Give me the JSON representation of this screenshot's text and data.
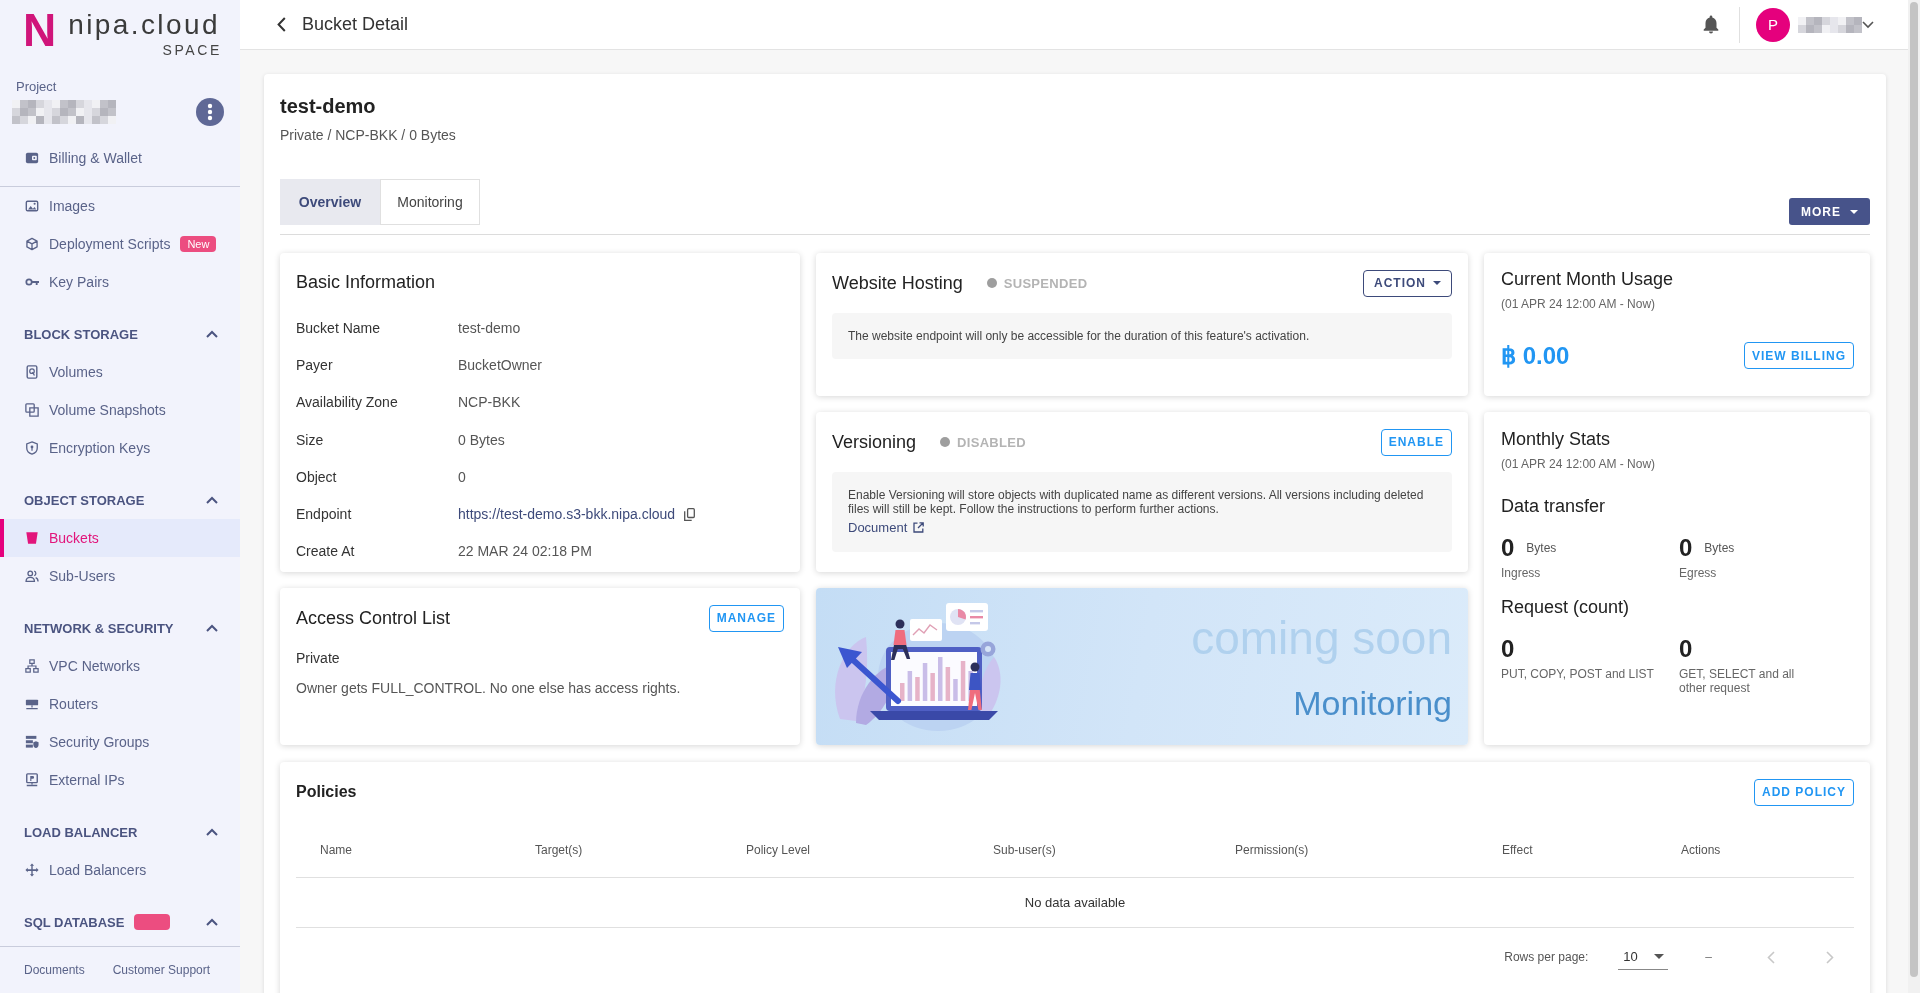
{
  "sidebar": {
    "logo": {
      "mark": "N",
      "name": "nipa.cloud",
      "tagline": "SPACE"
    },
    "project": {
      "label": "Project"
    },
    "pinned": [
      {
        "label": "Billing & Wallet",
        "selected": false
      }
    ],
    "sections": [
      {
        "items": [
          {
            "label": "Images",
            "selected": false
          },
          {
            "label": "Deployment Scripts",
            "badge": "New",
            "selected": false
          },
          {
            "label": "Key Pairs",
            "selected": false
          }
        ]
      },
      {
        "heading": "BLOCK STORAGE",
        "expanded": true,
        "items": [
          {
            "label": "Volumes",
            "selected": false
          },
          {
            "label": "Volume Snapshots",
            "selected": false
          },
          {
            "label": "Encryption Keys",
            "selected": false
          }
        ]
      },
      {
        "heading": "OBJECT STORAGE",
        "expanded": true,
        "items": [
          {
            "label": "Buckets",
            "selected": true
          },
          {
            "label": "Sub-Users",
            "selected": false
          }
        ]
      },
      {
        "heading": "NETWORK & SECURITY",
        "expanded": true,
        "items": [
          {
            "label": "VPC Networks",
            "selected": false
          },
          {
            "label": "Routers",
            "selected": false
          },
          {
            "label": "Security Groups",
            "selected": false
          },
          {
            "label": "External IPs",
            "selected": false
          }
        ]
      },
      {
        "heading": "LOAD BALANCER",
        "expanded": true,
        "items": [
          {
            "label": "Load Balancers",
            "selected": false
          }
        ]
      },
      {
        "heading": "SQL DATABASE",
        "tagged": true,
        "expanded": true
      }
    ],
    "footer_links": [
      "Documents",
      "Customer Support"
    ]
  },
  "header": {
    "title": "Bucket Detail",
    "avatar_initial": "P"
  },
  "bucket": {
    "name": "test-demo",
    "summary": "Private / NCP-BKK / 0 Bytes"
  },
  "tabs": [
    {
      "label": "Overview",
      "selected": true
    },
    {
      "label": "Monitoring",
      "selected": false
    }
  ],
  "more_button": "MORE",
  "basic_information": {
    "title": "Basic Information",
    "fields": [
      {
        "label": "Bucket Name",
        "value": "test-demo",
        "kind": "text"
      },
      {
        "label": "Payer",
        "value": "BucketOwner",
        "kind": "text"
      },
      {
        "label": "Availability Zone",
        "value": "NCP-BKK",
        "kind": "text"
      },
      {
        "label": "Size",
        "value": "0 Bytes",
        "kind": "text"
      },
      {
        "label": "Object",
        "value": "0",
        "kind": "text"
      },
      {
        "label": "Endpoint",
        "value": "https://test-demo.s3-bkk.nipa.cloud",
        "kind": "link"
      },
      {
        "label": "Create At",
        "value": "22 MAR 24 02:18 PM",
        "kind": "text"
      }
    ]
  },
  "features": [
    {
      "title": "Website Hosting",
      "status": "SUSPENDED",
      "active": false,
      "button": {
        "label": "ACTION",
        "kind": "menu"
      },
      "note": "The website endpoint will only be accessible for the duration of this feature's activation."
    },
    {
      "title": "Versioning",
      "status": "DISABLED",
      "active": false,
      "button": {
        "label": "ENABLE",
        "kind": "action"
      },
      "note": "Enable Versioning will store objects with duplicated name as different versions. All versions including deleted files will still be kept. Follow the instructions to perform further actions.",
      "link": "Document"
    }
  ],
  "access_control": {
    "title": "Access Control List",
    "button": "MANAGE",
    "permission": "Private",
    "description": "Owner gets FULL_CONTROL. No one else has access rights."
  },
  "monitoring_banner": {
    "headline": "coming soon",
    "title": "Monitoring"
  },
  "current_month_usage": {
    "title": "Current Month Usage",
    "period": "(01 APR 24 12:00 AM - Now)",
    "amount": "฿ 0.00",
    "button": "VIEW BILLING"
  },
  "monthly_stats": {
    "title": "Monthly Stats",
    "period": "(01 APR 24 12:00 AM - Now)",
    "groups": [
      {
        "heading": "Data transfer",
        "metrics": [
          {
            "value": "0",
            "unit": "Bytes",
            "label": "Ingress"
          },
          {
            "value": "0",
            "unit": "Bytes",
            "label": "Egress"
          }
        ]
      },
      {
        "heading": "Request (count)",
        "metrics": [
          {
            "value": "0",
            "label": "PUT, COPY, POST and LIST"
          },
          {
            "value": "0",
            "label": "GET, SELECT and all other request"
          }
        ]
      }
    ]
  },
  "policies": {
    "title": "Policies",
    "button": "ADD POLICY",
    "columns": [
      "Name",
      "Target(s)",
      "Policy Level",
      "Sub-user(s)",
      "Permission(s)",
      "Effect",
      "Actions"
    ],
    "empty_message": "No data available",
    "pagination": {
      "rows_label": "Rows per page:",
      "rows_per_page": "10",
      "range": "–",
      "previous_disabled": true,
      "next_disabled": true
    }
  }
}
